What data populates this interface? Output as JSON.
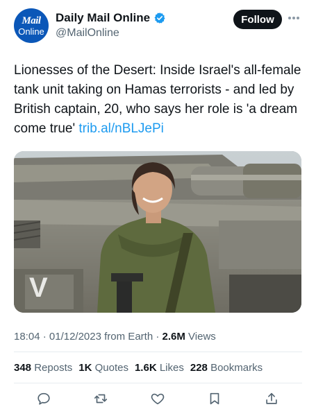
{
  "author": {
    "avatar_line1": "Mail",
    "avatar_line2": "Online",
    "display_name": "Daily Mail Online",
    "handle": "@MailOnline",
    "verified_icon": "verified-badge-icon"
  },
  "header": {
    "follow_label": "Follow",
    "more_icon": "more-horizontal-icon"
  },
  "tweet": {
    "text": "Lionesses of the Desert: Inside Israel's all-female tank unit taking on Hamas terrorists - and led by British captain, 20, who says her role is 'a dream come true'",
    "link": "trib.al/nBLJePi"
  },
  "media": {
    "description_icon": "photo-soldier-tank",
    "tank_marking": "V"
  },
  "meta": {
    "time": "18:04",
    "date": "01/12/2023",
    "source": "from Earth",
    "views_count": "2.6M",
    "views_label": "Views"
  },
  "stats": {
    "reposts_count": "348",
    "reposts_label": "Reposts",
    "quotes_count": "1K",
    "quotes_label": "Quotes",
    "likes_count": "1.6K",
    "likes_label": "Likes",
    "bookmarks_count": "228",
    "bookmarks_label": "Bookmarks"
  },
  "actions": {
    "reply_icon": "reply-icon",
    "repost_icon": "repost-icon",
    "like_icon": "heart-icon",
    "bookmark_icon": "bookmark-icon",
    "share_icon": "share-icon"
  },
  "colors": {
    "link": "#1d9bf0",
    "secondary_text": "#536471",
    "verified": "#1d9bf0",
    "follow_bg": "#0f1419",
    "avatar_bg": "#0b57b8"
  }
}
